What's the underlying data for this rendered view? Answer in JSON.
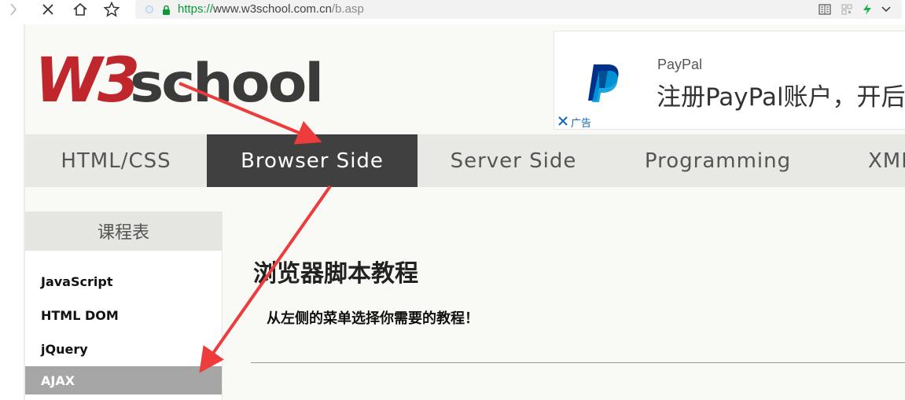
{
  "browser": {
    "url_scheme": "https://",
    "url_host": "www.w3school.com.cn",
    "url_path": "/b.asp"
  },
  "logo": {
    "text": "W3school",
    "colors": {
      "w3": "#c0272d",
      "school": "#3b3b3b"
    }
  },
  "ad": {
    "brand": "PayPal",
    "headline": "注册PayPal账户，开后",
    "tag": "广告",
    "colors": {
      "paypal_dark": "#003087",
      "paypal_light": "#009cde"
    }
  },
  "nav": {
    "items": [
      {
        "label": "HTML/CSS",
        "active": false
      },
      {
        "label": "Browser Side",
        "active": true
      },
      {
        "label": "Server Side",
        "active": false
      },
      {
        "label": "Programming",
        "active": false
      },
      {
        "label": "XML",
        "active": false
      }
    ]
  },
  "sidebar": {
    "title": "课程表",
    "items": [
      {
        "label": "JavaScript",
        "active": false
      },
      {
        "label": "HTML DOM",
        "active": false
      },
      {
        "label": "jQuery",
        "active": false
      },
      {
        "label": "AJAX",
        "active": true
      }
    ]
  },
  "main": {
    "title": "浏览器脚本教程",
    "description": "从左侧的菜单选择你需要的教程！"
  },
  "annotation": {
    "arrow_color": "#ee3b3b"
  }
}
